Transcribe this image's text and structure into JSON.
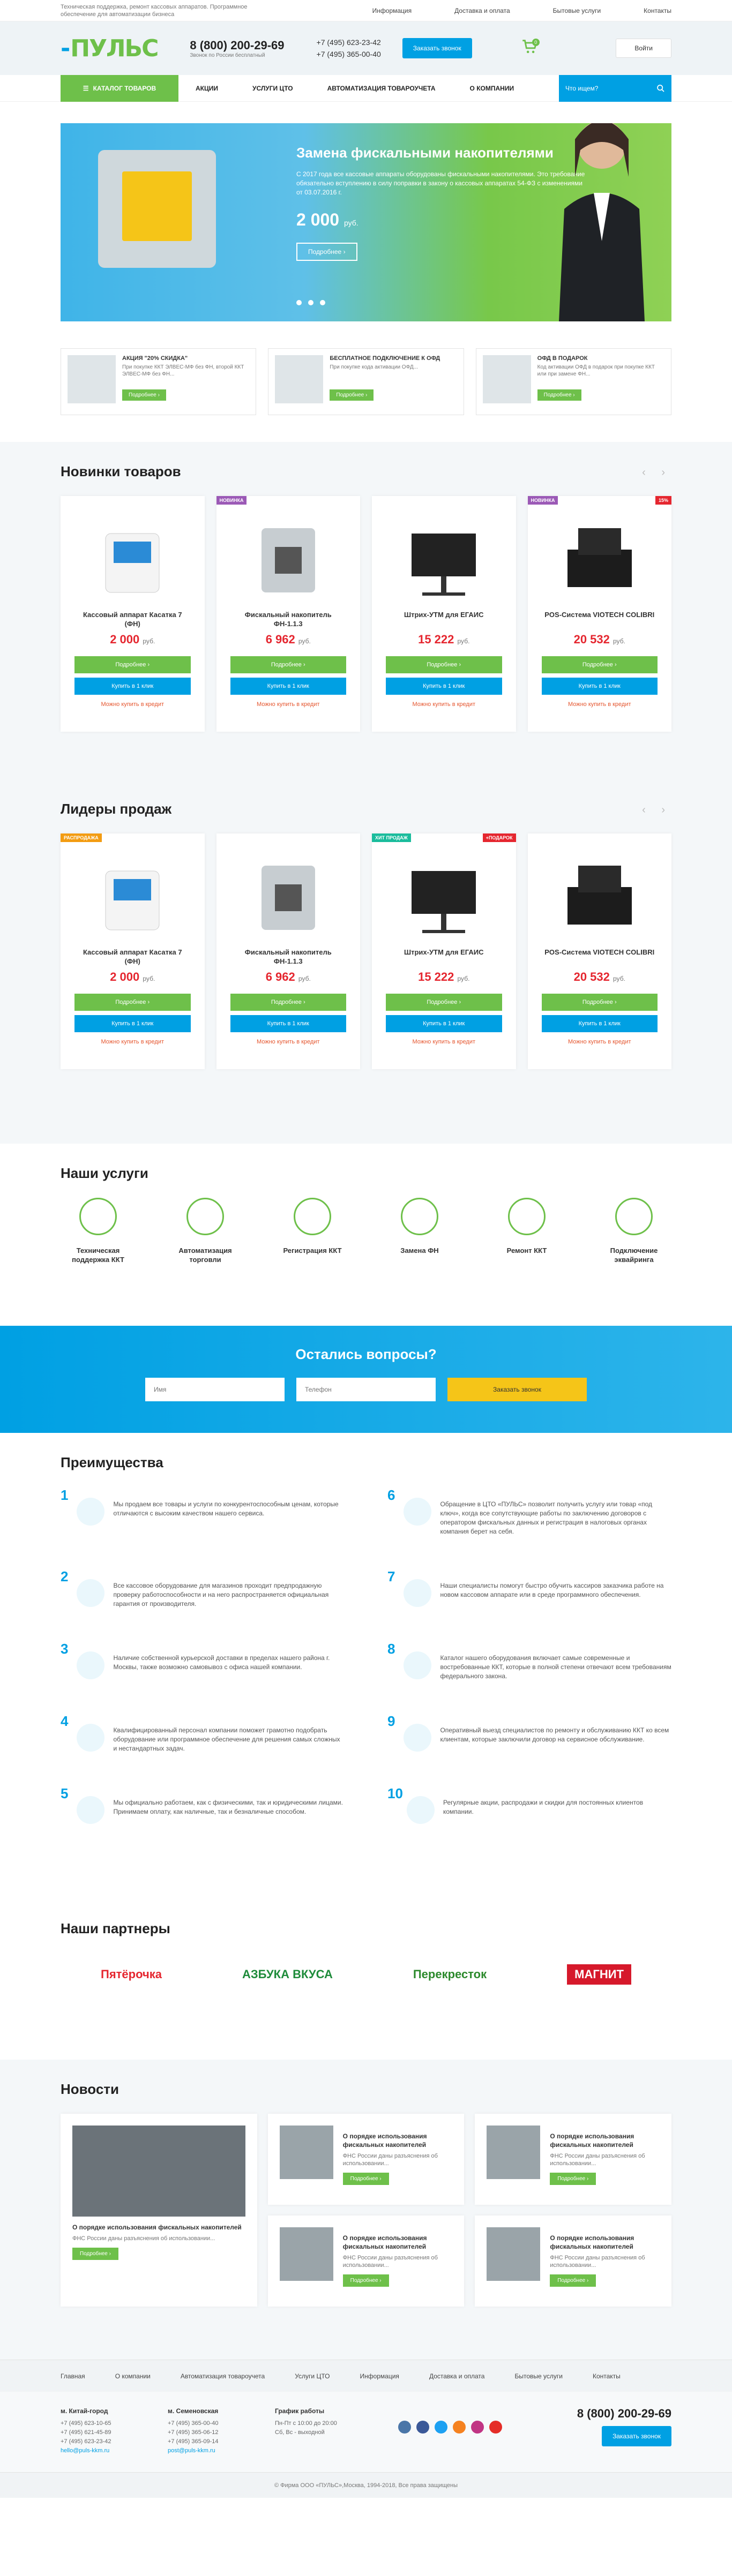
{
  "topbar": {
    "desc": "Техническая поддержка, ремонт кассовых аппаратов. Программное обеспечение для автоматизации бизнеса",
    "links": [
      "Информация",
      "Доставка и оплата",
      "Бытовые услуги",
      "Контакты"
    ]
  },
  "header": {
    "phone": "8 (800) 200-29-69",
    "phone_sub": "Звонок по России бесплатный",
    "phone2": "+7 (495) 623-23-42",
    "phone3": "+7 (495) 365-00-40",
    "call_btn": "Заказать звонок",
    "cart_count": "0",
    "login": "Войти"
  },
  "nav": {
    "catalog": "КАТАЛОГ ТОВАРОВ",
    "items": [
      "АКЦИИ",
      "УСЛУГИ ЦТО",
      "АВТОМАТИЗАЦИЯ ТОВАРОУЧЕТА",
      "О КОМПАНИИ"
    ],
    "search_placeholder": "Что ищем?"
  },
  "banner": {
    "title": "Замена фискальными накопителями",
    "text": "С 2017 года все кассовые аппараты оборудованы фискальными накопителями. Это требование обязательно вступлению в силу поправки в закону о кассовых аппаратах 54-ФЗ с изменениями от 03.07.2016 г.",
    "price": "2 000",
    "currency": "руб.",
    "btn": "Подробнее ›"
  },
  "promos": [
    {
      "title": "АКЦИЯ \"20% СКИДКА\"",
      "text": "При покупке ККТ ЭЛВЕС-МФ без ФН, второй ККТ ЭЛВЕС-МФ без ФН...",
      "btn": "Подробнее ›"
    },
    {
      "title": "БЕСПЛАТНОЕ ПОДКЛЮЧЕНИЕ К ОФД",
      "text": "При покупке кода активации ОФД...",
      "btn": "Подробнее ›"
    },
    {
      "title": "ОФД В ПОДАРОК",
      "text": "Код активации ОФД в подарок при покупке ККТ или при замене ФН...",
      "btn": "Подробнее ›"
    }
  ],
  "new_products": {
    "title": "Новинки товаров",
    "items": [
      {
        "name": "Кассовый аппарат Касатка 7 (ФН)",
        "price": "2 000",
        "currency": "руб.",
        "tag": "",
        "tag_right": ""
      },
      {
        "name": "Фискальный накопитель ФН-1.1.3",
        "price": "6 962",
        "currency": "руб.",
        "tag": "НОВИНКА",
        "tag_right": ""
      },
      {
        "name": "Штрих-УТМ для ЕГАИС",
        "price": "15 222",
        "currency": "руб.",
        "tag": "",
        "tag_right": ""
      },
      {
        "name": "POS-Система VIOTECH COLIBRI",
        "price": "20 532",
        "currency": "руб.",
        "tag": "НОВИНКА",
        "tag_right": "15%"
      }
    ]
  },
  "top_products": {
    "title": "Лидеры продаж",
    "items": [
      {
        "name": "Кассовый аппарат Касатка 7 (ФН)",
        "price": "2 000",
        "currency": "руб.",
        "tag": "РАСПРОДАЖА",
        "tag_right": ""
      },
      {
        "name": "Фискальный накопитель ФН-1.1.3",
        "price": "6 962",
        "currency": "руб.",
        "tag": "",
        "tag_right": ""
      },
      {
        "name": "Штрих-УТМ для ЕГАИС",
        "price": "15 222",
        "currency": "руб.",
        "tag": "ХИТ ПРОДАЖ",
        "tag_right": "+ПОДАРОК"
      },
      {
        "name": "POS-Система VIOTECH COLIBRI",
        "price": "20 532",
        "currency": "руб.",
        "tag": "",
        "tag_right": ""
      }
    ]
  },
  "product_buttons": {
    "more": "Подробнее ›",
    "buy": "Купить в 1 клик",
    "credit": "Можно купить в кредит"
  },
  "services": {
    "title": "Наши услуги",
    "items": [
      "Техническая поддержка ККТ",
      "Автоматизация торговли",
      "Регистрация ККТ",
      "Замена ФН",
      "Ремонт ККТ",
      "Подключение эквайринга"
    ]
  },
  "questions": {
    "title": "Остались вопросы?",
    "name_ph": "Имя",
    "phone_ph": "Телефон",
    "btn": "Заказать звонок"
  },
  "advantages": {
    "title": "Преимущества",
    "items": [
      {
        "n": "1",
        "text": "Мы продаем все товары и услуги по конкурентоспособным ценам, которые отличаются с высоким качеством нашего сервиса."
      },
      {
        "n": "6",
        "text": "Обращение в ЦТО «ПУЛЬС» позволит получить услугу или товар «под ключ», когда все сопутствующие работы по заключению договоров с оператором фискальных данных и регистрация в налоговых органах компания берет на себя."
      },
      {
        "n": "2",
        "text": "Все кассовое оборудование для магазинов проходит предпродажную проверку работоспособности и на него распространяется официальная гарантия от производителя."
      },
      {
        "n": "7",
        "text": "Наши специалисты помогут быстро обучить кассиров заказчика работе на новом кассовом аппарате или в среде программного обеспечения."
      },
      {
        "n": "3",
        "text": "Наличие собственной курьерской доставки в пределах нашего района г. Москвы, также возможно самовывоз с офиса нашей компании."
      },
      {
        "n": "8",
        "text": "Каталог нашего оборудования включает самые современные и востребованные ККТ, которые в полной степени отвечают всем требованиям федерального закона."
      },
      {
        "n": "4",
        "text": "Квалифицированный персонал компании поможет грамотно подобрать оборудование или программное обеспечение для решения самых сложных и нестандартных задач."
      },
      {
        "n": "9",
        "text": "Оперативный выезд специалистов по ремонту и обслуживанию ККТ ко всем клиентам, которые заключили договор на сервисное обслуживание."
      },
      {
        "n": "5",
        "text": "Мы официально работаем, как с физическими, так и юридическими лицами. Принимаем оплату, как наличные, так и безналичные способом."
      },
      {
        "n": "10",
        "text": "Регулярные акции, распродажи и скидки для постоянных клиентов компании."
      }
    ]
  },
  "partners": {
    "title": "Наши партнеры",
    "items": [
      "Пятёрочка",
      "АЗБУКА ВКУСА",
      "Перекресток",
      "МАГНИТ"
    ]
  },
  "news": {
    "title": "Новости",
    "item_title": "О порядке использования фискальных накопителей",
    "item_text": "ФНС России даны разъяснения об использовании...",
    "btn": "Подробнее ›"
  },
  "footer": {
    "nav": [
      "Главная",
      "О компании",
      "Автоматизация товароучета",
      "Услуги ЦТО",
      "Информация",
      "Доставка и оплата",
      "Бытовые услуги",
      "Контакты"
    ],
    "col1": {
      "title": "м. Китай-город",
      "lines": [
        "+7 (495) 623-10-65",
        "+7 (495) 621-45-89",
        "+7 (495) 623-23-42",
        "hello@puls-kkm.ru"
      ]
    },
    "col2": {
      "title": "м. Семеновская",
      "lines": [
        "+7 (495) 365-00-40",
        "+7 (495) 365-06-12",
        "+7 (495) 365-09-14",
        "post@puls-kkm.ru"
      ]
    },
    "col3": {
      "title": "График работы",
      "lines": [
        "Пн-Пт с 10:00 до 20:00",
        "Сб, Вс - выходной"
      ]
    },
    "phone": "8 (800) 200-29-69",
    "btn": "Заказать звонок",
    "copy": "© Фирма ООО «ПУЛЬС»,Москва, 1994-2018, Все права защищены"
  },
  "colors": {
    "green": "#6ec04a",
    "blue": "#00a0e3",
    "red": "#e5262f",
    "yellow": "#f5c518"
  }
}
